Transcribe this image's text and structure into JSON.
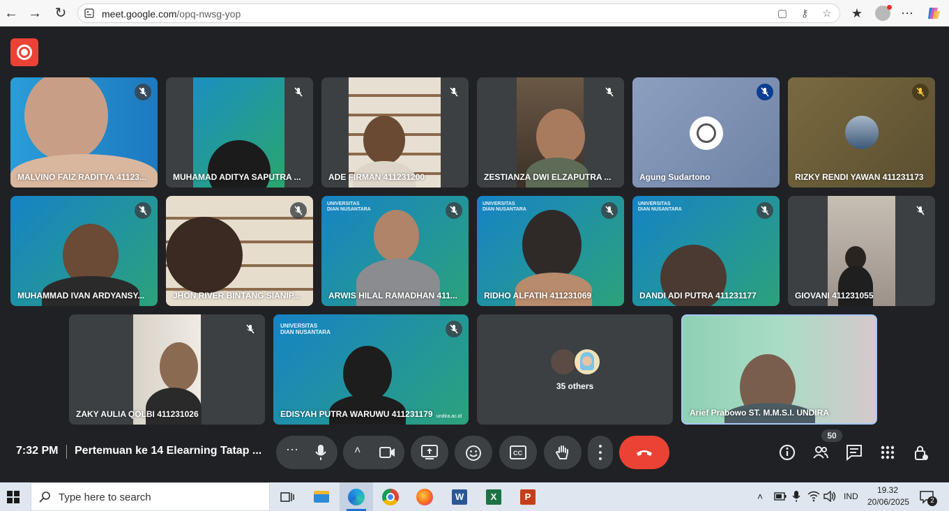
{
  "browser": {
    "url_domain": "meet.google.com",
    "url_path": "/opq-nwsg-yop"
  },
  "tiles": [
    {
      "name": "MALVINO FAIZ RADITYA 41123...",
      "mic_muted": true
    },
    {
      "name": "MUHAMAD ADITYA SAPUTRA ...",
      "mic_muted": true
    },
    {
      "name": "ADE FIRMAN 411231200",
      "mic_muted": true
    },
    {
      "name": "ZESTIANZA DWI ELZAPUTRA ...",
      "mic_muted": true
    },
    {
      "name": "Agung Sudartono",
      "mic_muted": true
    },
    {
      "name": "RIZKY RENDI YAWAN 411231173",
      "mic_muted": true
    },
    {
      "name": "MUHAMMAD IVAN ARDYANSY...",
      "mic_muted": true
    },
    {
      "name": "JHON RIVER BINTANG SIANIP...",
      "mic_muted": true
    },
    {
      "name": "ARWIS HILAL RAMADHAN 411...",
      "mic_muted": true
    },
    {
      "name": "RIDHO ALFATIH 411231069",
      "mic_muted": true
    },
    {
      "name": "DANDI ADI PUTRA 411231177",
      "mic_muted": true
    },
    {
      "name": "GIOVANI 411231055",
      "mic_muted": true
    },
    {
      "name": "ZAKY AULIA QOLBI 411231026",
      "mic_muted": true
    },
    {
      "name": "EDISYAH PUTRA WARUWU 411231179",
      "mic_muted": true
    },
    {
      "name": "35 others",
      "mic_muted": false
    },
    {
      "name": "Arief Prabowo ST. M.M.S.I. UNDIRA",
      "mic_muted": false
    }
  ],
  "brand_text": {
    "line1": "UNIVERSITAS",
    "line2": "DIAN NUSANTARA",
    "footer": "undira.ac.id"
  },
  "bottom_bar": {
    "time": "7:32 PM",
    "meeting_title": "Pertemuan ke 14 Elearning Tatap ...",
    "participant_count": "50"
  },
  "taskbar": {
    "search_placeholder": "Type here to search",
    "language": "IND",
    "clock_time": "19.32",
    "clock_date": "20/06/2025",
    "notification_count": "2"
  },
  "colors": {
    "meet_bg": "#202124",
    "tile_bg": "#3c4043",
    "end_call": "#ea4335",
    "record": "#ea4335",
    "active_speaker_border": "#a8c7fa"
  }
}
